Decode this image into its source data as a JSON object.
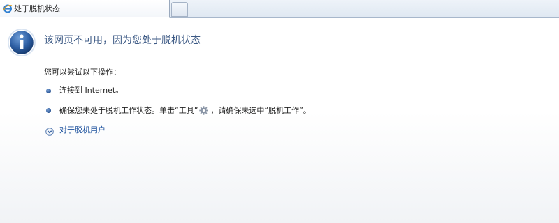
{
  "tab": {
    "title": "处于脱机状态",
    "icon": "ie-page-icon",
    "new_tab_icon": "new-tab-button"
  },
  "main": {
    "icon": "info-icon",
    "heading": "该网页不可用，因为您处于脱机状态",
    "intro": "您可以尝试以下操作：",
    "items": [
      {
        "text": "连接到 Internet。"
      },
      {
        "text_before": "确保您未处于脱机工作状态。单击“工具”",
        "icon": "gear-icon",
        "text_after": "，请确保未选中“脱机工作”。"
      }
    ],
    "expand": {
      "icon": "chevron-down-circle-icon",
      "label": "对于脱机用户"
    }
  },
  "colors": {
    "heading": "#3d5a85",
    "link": "#1a4f9c",
    "bullet": "#2f5c9d",
    "rule": "#c9c9c9"
  }
}
